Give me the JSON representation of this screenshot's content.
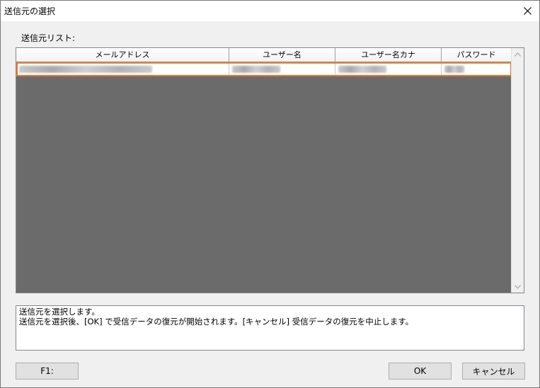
{
  "window": {
    "title": "送信元の選択"
  },
  "list": {
    "label": "送信元リスト:",
    "columns": [
      "メールアドレス",
      "ユーザー名",
      "ユーザー名カナ",
      "パスワード"
    ],
    "rows": [
      {
        "cells": [
          "",
          "",
          "",
          ""
        ],
        "selected": true,
        "redacted": true
      }
    ]
  },
  "message": {
    "line1": "送信元を選択します。",
    "line2": "送信元を選択後、[OK] で受信データの復元が開始されます。[キャンセル] 受信データの復元を中止します。"
  },
  "buttons": {
    "f1": "F1:",
    "ok": "OK",
    "cancel": "キャンセル"
  },
  "colors": {
    "selection_outline": "#e87a2e",
    "grid_background": "#6b6b6b"
  },
  "icons": {
    "close": "close-icon",
    "scroll_up": "chevron-up-icon",
    "scroll_down": "chevron-down-icon"
  }
}
